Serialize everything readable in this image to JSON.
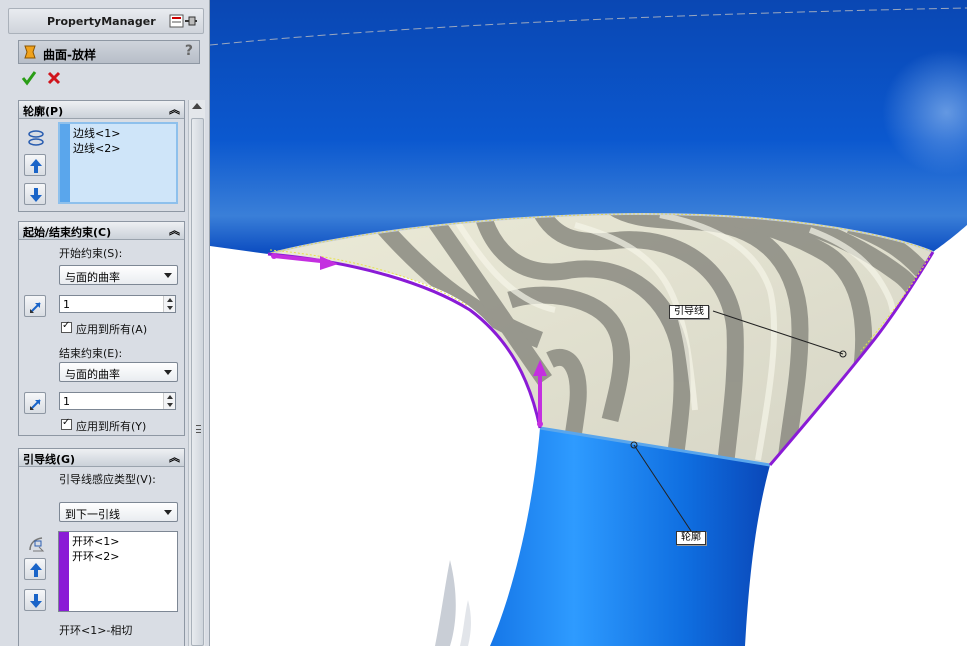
{
  "panel": {
    "title": "PropertyManager",
    "feature": {
      "title": "曲面-放样"
    }
  },
  "profiles": {
    "title": "轮廓(P)",
    "items": [
      "边线<1>",
      "边线<2>"
    ]
  },
  "constraints": {
    "title": "起始/结束约束(C)",
    "start_label": "开始约束(S):",
    "start_value": "与面的曲率",
    "start_amount": "1",
    "start_apply_all": "应用到所有(A)",
    "end_label": "结束约束(E):",
    "end_value": "与面的曲率",
    "end_amount": "1",
    "end_apply_all": "应用到所有(Y)"
  },
  "guides": {
    "title": "引导线(G)",
    "influence_label": "引导线感应类型(V):",
    "influence_value": "到下一引线",
    "items": [
      "开环<1>",
      "开环<2>"
    ],
    "selected": "开环<1>-相切"
  },
  "viewport": {
    "callout_guide": "引导线",
    "callout_profile": "轮廓"
  },
  "colors": {
    "surface_blue": "#0b53c9",
    "guide_purple": "#8a1bd6",
    "profile_stripe": "#5aa6ec"
  }
}
